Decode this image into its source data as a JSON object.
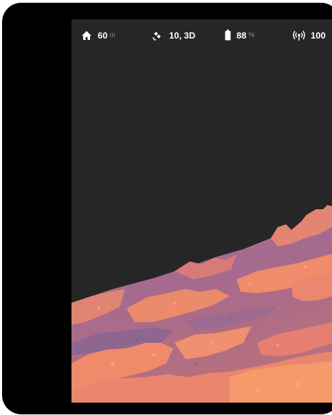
{
  "status_bar": {
    "altitude": {
      "icon": "home-icon",
      "value": "60",
      "unit": "m"
    },
    "gps": {
      "icon": "satellite-icon",
      "value": "10, 3D"
    },
    "battery": {
      "icon": "battery-icon",
      "value": "88",
      "unit": "%"
    },
    "signal": {
      "icon": "signal-icon",
      "value": "100"
    }
  },
  "viewport": {
    "content": "aerial-3d-terrain-view"
  },
  "colors": {
    "background": "#262626",
    "status_text": "#ffffff",
    "unit_text": "#8c8c8c",
    "terrain_light": "#f08a6c",
    "terrain_dark": "#9a6a8e"
  }
}
